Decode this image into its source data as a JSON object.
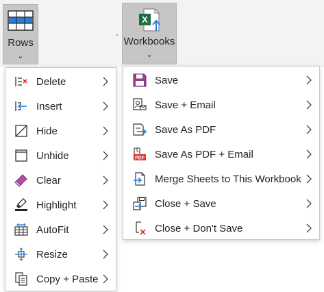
{
  "ribbon": {
    "rows_button": {
      "label": "Rows",
      "chevron": "⌄",
      "icon": "rows-grid-icon"
    },
    "workbooks_button": {
      "label": "Workbooks",
      "chevron": "⌄",
      "icon": "excel-workbook-icon"
    }
  },
  "rows_menu": {
    "items": [
      {
        "label": "Delete",
        "icon": "delete-row-icon"
      },
      {
        "label": "Insert",
        "icon": "insert-row-icon"
      },
      {
        "label": "Hide",
        "icon": "hide-icon"
      },
      {
        "label": "Unhide",
        "icon": "unhide-icon"
      },
      {
        "label": "Clear",
        "icon": "eraser-icon"
      },
      {
        "label": "Highlight",
        "icon": "highlighter-icon"
      },
      {
        "label": "AutoFit",
        "icon": "autofit-icon"
      },
      {
        "label": "Resize",
        "icon": "resize-icon"
      },
      {
        "label": "Copy + Paste",
        "icon": "copy-paste-icon"
      }
    ]
  },
  "workbooks_menu": {
    "items": [
      {
        "label": "Save",
        "icon": "save-icon"
      },
      {
        "label": "Save + Email",
        "icon": "save-email-icon"
      },
      {
        "label": "Save As PDF",
        "icon": "save-pdf-icon"
      },
      {
        "label": "Save As PDF + Email",
        "icon": "pdf-email-icon"
      },
      {
        "label": "Merge Sheets to This Workbook",
        "icon": "merge-sheets-icon"
      },
      {
        "label": "Close + Save",
        "icon": "close-save-icon"
      },
      {
        "label": "Close + Don't Save",
        "icon": "close-no-save-icon"
      }
    ]
  },
  "colors": {
    "ribbon_bg": "#f3f3f3",
    "pressed_button_bg": "#c6c6c6",
    "icon_blue": "#2b7cd3",
    "excel_green": "#1d6f42",
    "save_purple": "#9b3c8c",
    "clear_purple": "#b04fa7",
    "pdf_red": "#d9342b"
  }
}
